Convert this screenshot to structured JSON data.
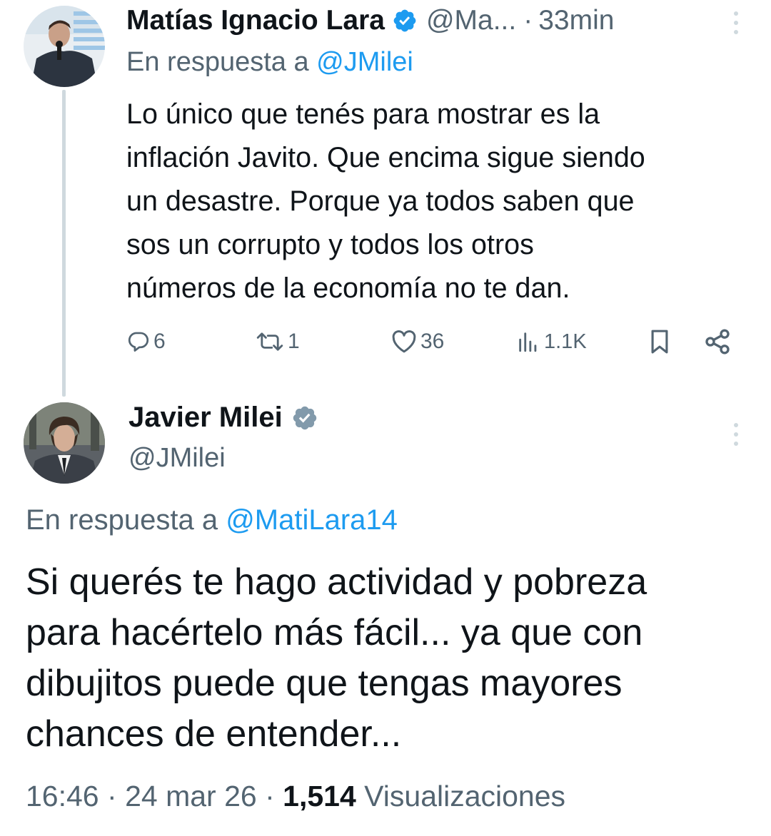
{
  "reply_tweet": {
    "author_name": "Matías Ignacio Lara",
    "author_handle": "@Ma...",
    "separator": "·",
    "time": "33min",
    "reply_prefix": "En respuesta a",
    "reply_handle": "@JMilei",
    "body_lines": [
      "Lo único que tenés para mostrar es la",
      "inflación Javito. Que encima sigue siendo",
      "un desastre. Porque ya todos saben que",
      "sos un corrupto y todos los otros",
      "números de la economía no te dan."
    ],
    "actions": {
      "replies": "6",
      "retweets": "1",
      "likes": "36",
      "views": "1.1K"
    },
    "icons": [
      "reply-icon",
      "retweet-icon",
      "like-icon",
      "views-icon",
      "bookmark-icon",
      "share-icon",
      "more-icon",
      "verified-icon"
    ]
  },
  "main_tweet": {
    "author_name": "Javier Milei",
    "author_handle": "@JMilei",
    "reply_prefix": "En respuesta a",
    "reply_handle": "@MatiLara14",
    "body_lines": [
      "Si querés te hago actividad y pobreza",
      "para hacértelo más fácil... ya que con",
      "dibujitos puede que tengas mayores",
      "chances de entender..."
    ],
    "time": "16:46",
    "date": "24 mar 26",
    "separator": "·",
    "views_count": "1,514",
    "views_label": "Visualizaciones"
  },
  "colors": {
    "text": "#0f1419",
    "secondary": "#536471",
    "accent": "#1d9bf0",
    "thread_line": "#cfd9de",
    "verified_badge_top": "#1d9bf0",
    "verified_badge_main": "#829aab"
  }
}
